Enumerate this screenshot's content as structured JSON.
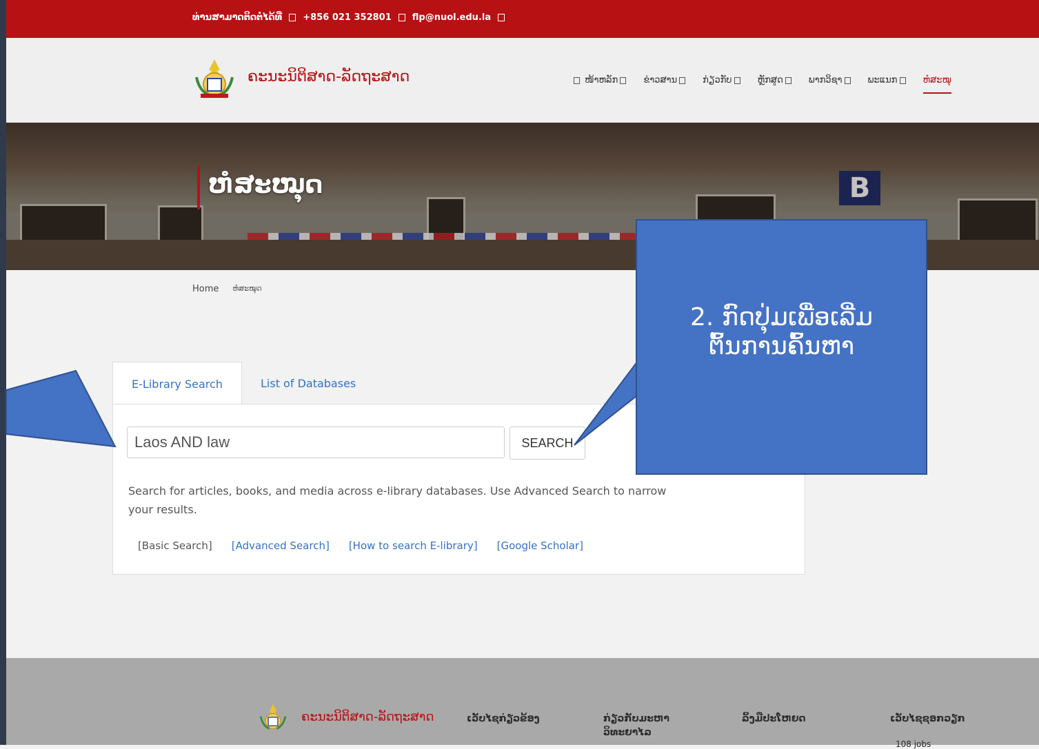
{
  "topbar": {
    "contact_label": "ທ່ານສາມາດຕິດຕໍ່ໄດ້ທີ່",
    "phone": "+856 021 352801",
    "email": "flp@nuol.edu.la"
  },
  "header": {
    "site_title": "ຄະນະນິຕິສາດ-ລັດຖະສາດ",
    "nav": [
      "ໜ້າຫລັກ",
      "ຂ່າວສານ",
      "ກ່ຽວກັບ",
      "ຫຼັກສູດ",
      "ພາກວິຊາ",
      "ພະແນກ",
      "ຫໍສະໝຸ"
    ]
  },
  "hero": {
    "title": "ຫໍສະໝຸດ",
    "sign": "B"
  },
  "breadcrumb": {
    "home": "Home",
    "current": "ຫໍສະໝຸດ"
  },
  "search": {
    "tabs": [
      "E-Library Search",
      "List of Databases"
    ],
    "query": "Laos AND law",
    "button": "SEARCH",
    "description": "Search for articles, books, and media across e-library databases. Use Advanced Search to narrow your results.",
    "links": [
      "[Basic Search]",
      "[Advanced Search]",
      "[How to search E-library]",
      "[Google Scholar]"
    ]
  },
  "callout": {
    "line1": "2. ກົດປຸ່ມເພື່ອເລີ່ມ",
    "line2": "ຕົ້ນການຄົ້ນຫາ"
  },
  "footer": {
    "title": "ຄະນະນິຕິສາດ-ລັດຖະສາດ",
    "col1": "ເວັບໄຊກ່ຽວຂ້ອງ",
    "col2_a": "ກ່ຽວກັບມະຫາ",
    "col2_b": "ວິທະຍາໄລ",
    "col3": "ລິ້ງມືປະໂຫຍດ",
    "col4": "ເວັບໄຊຊອກວຽກ",
    "col4_sub": "108 jobs"
  },
  "colors": {
    "brand_red": "#b71114",
    "link_blue": "#3372c5",
    "callout_blue": "#4472c4"
  }
}
